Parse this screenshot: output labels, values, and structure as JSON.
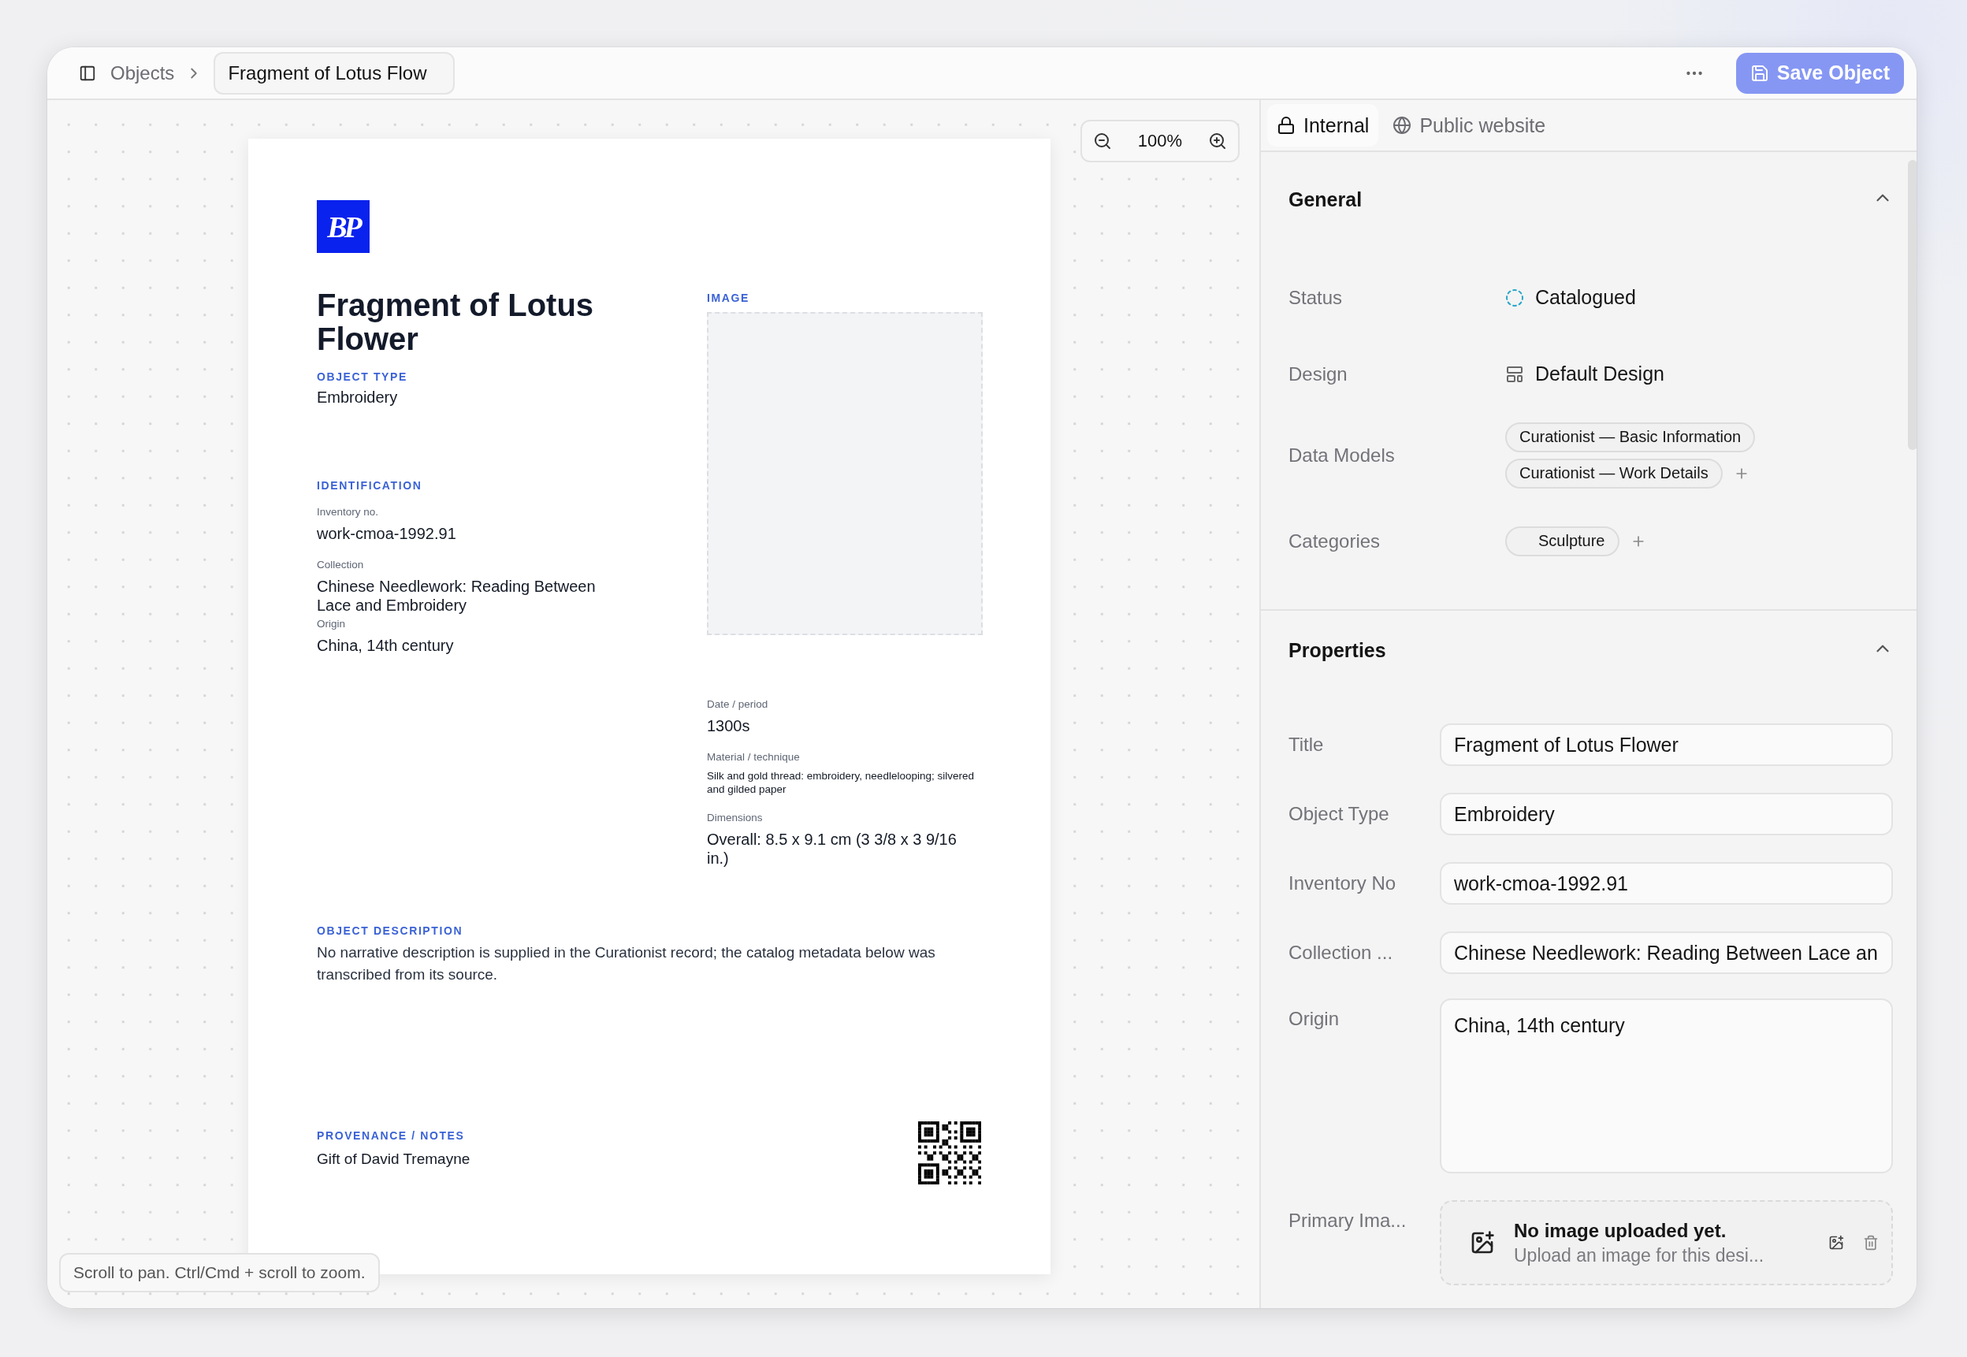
{
  "topbar": {
    "breadcrumb": "Objects",
    "current_tab": "Fragment of Lotus Flow",
    "save_button": "Save Object"
  },
  "canvas": {
    "zoom": "100%",
    "hint": "Scroll to pan. Ctrl/Cmd + scroll to zoom."
  },
  "document": {
    "logo": "BP",
    "title": "Fragment of Lotus Flower",
    "object_type": {
      "label": "OBJECT TYPE",
      "value": "Embroidery"
    },
    "identification": {
      "heading": "IDENTIFICATION",
      "fields": [
        {
          "label": "Inventory no.",
          "value": "work-cmoa-1992.91"
        },
        {
          "label": "Collection",
          "value": "Chinese Needlework: Reading Between Lace and Embroidery"
        },
        {
          "label": "Origin",
          "value": "China, 14th century"
        }
      ]
    },
    "image": {
      "label": "IMAGE"
    },
    "details": [
      {
        "label": "Date / period",
        "value": "1300s",
        "kind": "normal"
      },
      {
        "label": "Material / technique",
        "value": "Silk and gold thread: embroidery, needlelooping; silvered and gilded paper",
        "kind": "small"
      },
      {
        "label": "Dimensions",
        "value": "Overall: 8.5 x 9.1 cm (3 3/8 x 3 9/16 in.)",
        "kind": "normal"
      }
    ],
    "description": {
      "heading": "OBJECT DESCRIPTION",
      "text": "No narrative description is supplied in the Curationist record; the catalog metadata below was transcribed from its source."
    },
    "provenance": {
      "heading": "PROVENANCE / NOTES",
      "text": "Gift of David Tremayne"
    }
  },
  "panel": {
    "tabs": [
      {
        "label": "Internal",
        "kind": "lock",
        "selected": true
      },
      {
        "label": "Public website",
        "kind": "globe",
        "selected": false
      }
    ],
    "general": {
      "title": "General",
      "expanded": true,
      "rows": [
        {
          "label": "Status",
          "kind": "status",
          "value": "Catalogued"
        },
        {
          "label": "Design",
          "kind": "design",
          "value": "Default Design"
        },
        {
          "label": "Data Models",
          "kind": "chips",
          "chips": [
            "Curationist — Basic Information",
            "Curationist — Work Details"
          ]
        },
        {
          "label": "Categories",
          "kind": "chips",
          "chips": [
            "Sculpture"
          ]
        }
      ]
    },
    "properties": {
      "title": "Properties",
      "expanded": true,
      "rows": [
        {
          "label": "Title",
          "kind": "input",
          "value": "Fragment of Lotus Flower"
        },
        {
          "label": "Object Type",
          "kind": "input",
          "value": "Embroidery"
        },
        {
          "label": "Inventory No",
          "kind": "input",
          "value": "work-cmoa-1992.91"
        },
        {
          "label": "Collection ...",
          "kind": "input",
          "value": "Chinese Needlework: Reading Between Lace an"
        },
        {
          "label": "Origin",
          "kind": "textarea",
          "value": "China, 14th century"
        },
        {
          "label": "Primary Ima...",
          "kind": "image",
          "title": "No image uploaded yet.",
          "subtitle": "Upload an image for this desi..."
        }
      ]
    }
  }
}
